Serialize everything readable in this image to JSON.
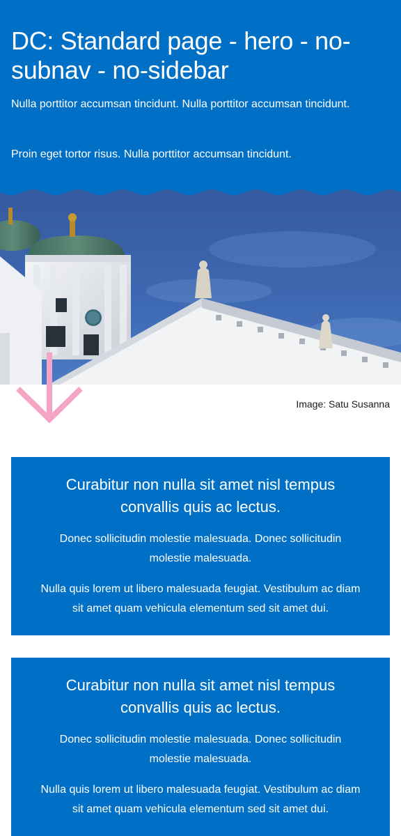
{
  "hero": {
    "title": "DC: Standard page - hero - no-subnav - no-sidebar",
    "paragraphs": [
      "Nulla porttitor accumsan tincidunt. Nulla porttitor accumsan tincidunt.",
      "Proin eget tortor risus. Nulla porttitor accumsan tincidunt."
    ]
  },
  "image": {
    "caption": "Image: Satu Susanna"
  },
  "cards": [
    {
      "title": "Curabitur non nulla sit amet nisl tempus convallis quis ac lectus.",
      "paragraphs": [
        "Donec sollicitudin molestie malesuada. Donec sollicitudin molestie malesuada.",
        "Nulla quis lorem ut libero malesuada feugiat. Vestibulum ac diam sit amet quam vehicula elementum sed sit amet dui."
      ]
    },
    {
      "title": "Curabitur non nulla sit amet nisl tempus convallis quis ac lectus.",
      "paragraphs": [
        "Donec sollicitudin molestie malesuada. Donec sollicitudin molestie malesuada.",
        "Nulla quis lorem ut libero malesuada feugiat. Vestibulum ac diam sit amet quam vehicula elementum sed sit amet dui."
      ]
    }
  ],
  "colors": {
    "brand_blue": "#0070c6",
    "arrow_pink": "#f5a4c6",
    "sky": "#3d69b4"
  },
  "icons": {
    "scroll_arrow": "arrow-down-icon"
  }
}
